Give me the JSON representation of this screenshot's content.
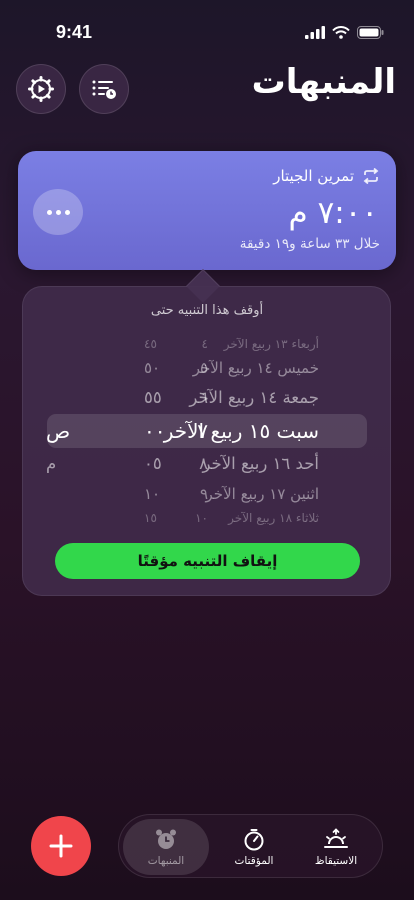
{
  "status_bar": {
    "time": "9:41"
  },
  "header": {
    "title": "المنبهات"
  },
  "alarm": {
    "label": "تمرين الجيتار",
    "time": "٧:٠٠ م",
    "remaining": "خلال ٣٣ ساعة و١٩ دقيقة"
  },
  "snooze_popover": {
    "title": "أوقف هذا التنبيه حتى",
    "rows": [
      {
        "date": "أربعاء ١٣ ربيع الآخر",
        "hour": "٤",
        "minute": "٤٥",
        "ampm": ""
      },
      {
        "date": "خميس ١٤ ربيع الآخر",
        "hour": "٥",
        "minute": "٥٠",
        "ampm": ""
      },
      {
        "date": "جمعة ١٤ ربيع الآخر",
        "hour": "٦",
        "minute": "٥٥",
        "ampm": ""
      },
      {
        "date": "سبت ١٥ ربيع الآخر",
        "hour": "٧",
        "minute": "٠٠",
        "ampm": "ص"
      },
      {
        "date": "أحد ١٦ ربيع الآخر",
        "hour": "٨",
        "minute": "٠٥",
        "ampm": "م"
      },
      {
        "date": "اثنين ١٧ ربيع الآخر",
        "hour": "٩",
        "minute": "١٠",
        "ampm": ""
      },
      {
        "date": "ثلاثاء ١٨ ربيع الآخر",
        "hour": "١٠",
        "minute": "١٥",
        "ampm": ""
      }
    ],
    "selected_index": 3,
    "stop_label": "إيقاف التنبيه مؤقتًا"
  },
  "tabs": [
    {
      "label": "المنبهات",
      "icon": "alarm-clock-icon",
      "active": true
    },
    {
      "label": "المؤقتات",
      "icon": "timer-icon",
      "active": false
    },
    {
      "label": "الاستيقاظ",
      "icon": "sunrise-icon",
      "active": false
    }
  ],
  "colors": {
    "card": "#7b7fe4",
    "stop_button": "#32d74b",
    "add_button": "#f0454b"
  }
}
